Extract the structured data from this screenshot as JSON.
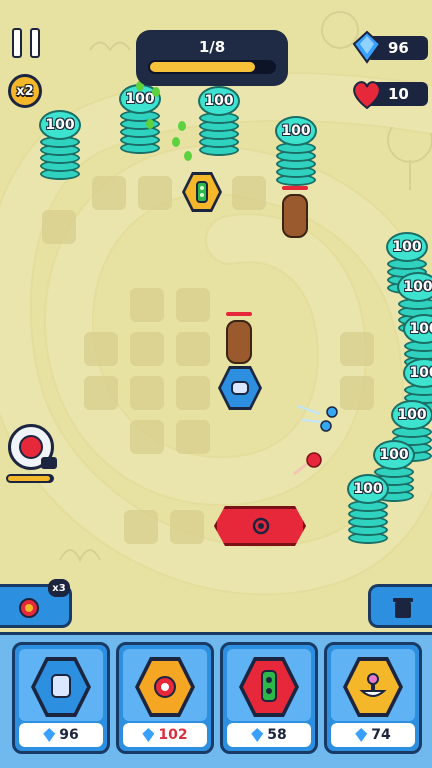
{
  "hud": {
    "wave": "1/8",
    "wave_progress": 0.85,
    "gems": "96",
    "lives": "10",
    "speed": "x2"
  },
  "stacks": [
    {
      "label": "100"
    },
    {
      "label": "100"
    },
    {
      "label": "100"
    },
    {
      "label": "100"
    },
    {
      "label": "100"
    },
    {
      "label": "100"
    },
    {
      "label": "100"
    },
    {
      "label": "100"
    },
    {
      "label": "100"
    },
    {
      "label": "100"
    },
    {
      "label": "100"
    }
  ],
  "side": {
    "left_badge": "x3"
  },
  "shop": [
    {
      "name": "blue-tower",
      "price": "96",
      "price_color": "#1c2540",
      "color": "#2d8fe0"
    },
    {
      "name": "orange-tower",
      "price": "102",
      "price_color": "#d8313f",
      "color": "#2d8fe0"
    },
    {
      "name": "red-tower",
      "price": "58",
      "price_color": "#1c2540",
      "color": "#2d8fe0"
    },
    {
      "name": "yellow-tower",
      "price": "74",
      "price_color": "#1c2540",
      "color": "#2d8fe0"
    }
  ],
  "colors": {
    "accent_blue": "#2d8fe0",
    "coin_teal": "#3de3cf",
    "enemy_brown": "#9b5a2e",
    "button_red": "#e6283a"
  }
}
